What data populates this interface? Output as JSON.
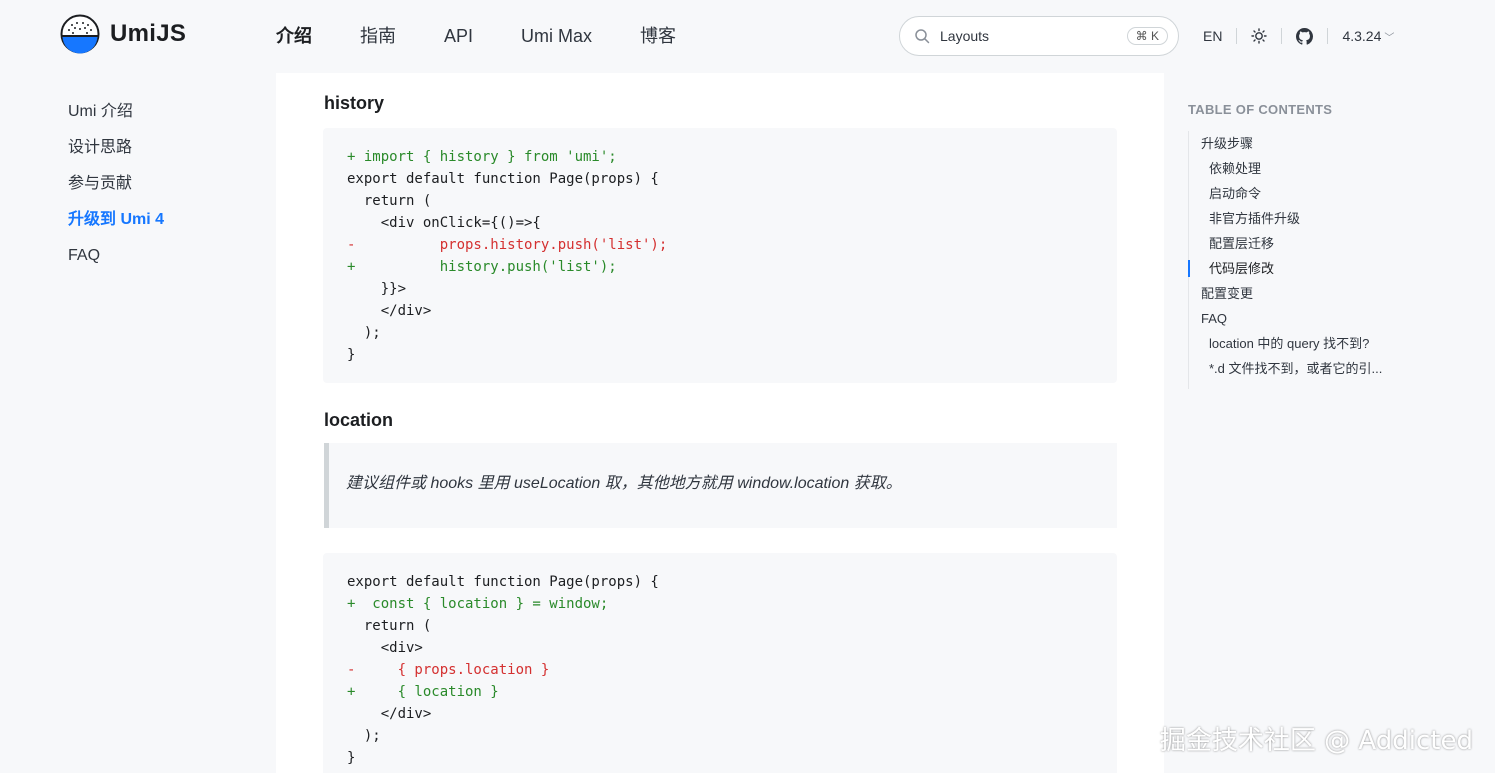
{
  "header": {
    "logo_text": "UmiJS",
    "nav": [
      {
        "label": "介绍",
        "active": true
      },
      {
        "label": "指南",
        "active": false
      },
      {
        "label": "API",
        "active": false
      },
      {
        "label": "Umi Max",
        "active": false
      },
      {
        "label": "博客",
        "active": false
      }
    ],
    "search": {
      "value": "Layouts",
      "shortcut": "⌘ K"
    },
    "lang": "EN",
    "version": "4.3.24"
  },
  "sidebar": {
    "items": [
      {
        "label": "Umi 介绍",
        "active": false
      },
      {
        "label": "设计思路",
        "active": false
      },
      {
        "label": "参与贡献",
        "active": false
      },
      {
        "label": "升级到 Umi 4",
        "active": true
      },
      {
        "label": "FAQ",
        "active": false
      }
    ]
  },
  "main": {
    "section1_title": "history",
    "code1": [
      {
        "type": "add",
        "text": "+ import { history } from 'umi';"
      },
      {
        "type": "normal",
        "text": "export default function Page(props) {"
      },
      {
        "type": "normal",
        "text": "  return ("
      },
      {
        "type": "normal",
        "text": "    <div onClick={()=>{"
      },
      {
        "type": "del",
        "text": "-          props.history.push('list');"
      },
      {
        "type": "add",
        "text": "+          history.push('list');"
      },
      {
        "type": "normal",
        "text": "    }}>"
      },
      {
        "type": "normal",
        "text": "    </div>"
      },
      {
        "type": "normal",
        "text": "  );"
      },
      {
        "type": "normal",
        "text": "}"
      }
    ],
    "section2_title": "location",
    "quote": "建议组件或 hooks 里用 useLocation 取，其他地方就用 window.location 获取。",
    "code2": [
      {
        "type": "normal",
        "text": "export default function Page(props) {"
      },
      {
        "type": "add",
        "text": "+  const { location } = window;"
      },
      {
        "type": "normal",
        "text": "  return ("
      },
      {
        "type": "normal",
        "text": "    <div>"
      },
      {
        "type": "del",
        "text": "-     { props.location }"
      },
      {
        "type": "add",
        "text": "+     { location }"
      },
      {
        "type": "normal",
        "text": "    </div>"
      },
      {
        "type": "normal",
        "text": "  );"
      },
      {
        "type": "normal",
        "text": "}"
      }
    ]
  },
  "toc": {
    "title": "TABLE OF CONTENTS",
    "items": [
      {
        "label": "升级步骤",
        "level": 1
      },
      {
        "label": "依赖处理",
        "level": 2
      },
      {
        "label": "启动命令",
        "level": 2
      },
      {
        "label": "非官方插件升级",
        "level": 2
      },
      {
        "label": "配置层迁移",
        "level": 2
      },
      {
        "label": "代码层修改",
        "level": 2,
        "active": true
      },
      {
        "label": "配置变更",
        "level": 1
      },
      {
        "label": "FAQ",
        "level": 1
      },
      {
        "label": "location 中的 query 找不到?",
        "level": 2
      },
      {
        "label": "*.d 文件找不到，或者它的引...",
        "level": 2
      }
    ]
  },
  "watermark": "掘金技术社区 @ Addicted",
  "colors": {
    "accent": "#1677ff",
    "add": "#2a8a2a",
    "del": "#d43030"
  },
  "icons": [
    "umi-logo-icon",
    "search-icon",
    "sun-icon",
    "github-icon",
    "chevron-down-icon"
  ]
}
